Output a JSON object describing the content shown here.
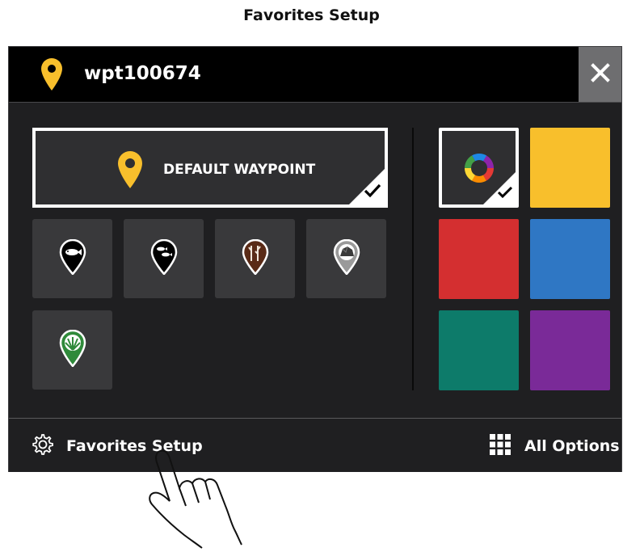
{
  "caption": "Favorites Setup",
  "header": {
    "title": "wpt100674",
    "pin_icon": "waypoint-pin-icon",
    "close_icon": "close-icon"
  },
  "default_waypoint": {
    "label": "DEFAULT WAYPOINT",
    "selected": true
  },
  "icons": [
    {
      "name": "fish-waypoint-icon"
    },
    {
      "name": "fish-school-waypoint-icon"
    },
    {
      "name": "timber-waypoint-icon"
    },
    {
      "name": "rock-waypoint-icon"
    },
    {
      "name": "vegetation-waypoint-icon"
    }
  ],
  "colors": [
    {
      "name": "multicolor",
      "hex": "#2f2f31",
      "selected": true
    },
    {
      "name": "yellow",
      "hex": "#f8bf2c"
    },
    {
      "name": "red",
      "hex": "#d42f30"
    },
    {
      "name": "blue",
      "hex": "#2f77c4"
    },
    {
      "name": "teal",
      "hex": "#0d7b6a"
    },
    {
      "name": "purple",
      "hex": "#7a2a98"
    }
  ],
  "footer": {
    "favorites_setup_label": "Favorites Setup",
    "all_options_label": "All Options"
  }
}
